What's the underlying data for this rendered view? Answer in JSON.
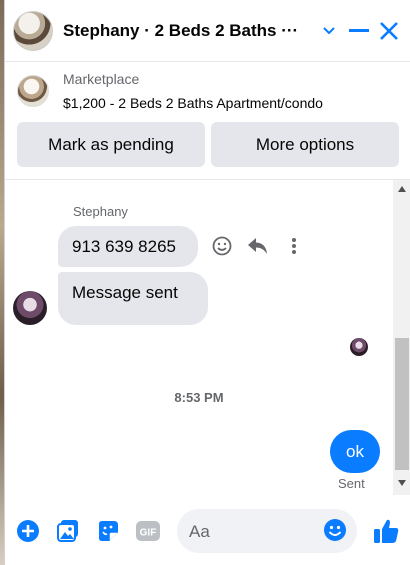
{
  "header": {
    "title": "Stephany · 2 Beds 2 Baths ···"
  },
  "marketplace": {
    "label": "Marketplace",
    "listing": "$1,200 - 2 Beds 2 Baths Apartment/condo"
  },
  "actions": {
    "mark_pending": "Mark as pending",
    "more_options": "More options"
  },
  "messages": {
    "sender_name": "Stephany",
    "incoming": [
      "913 639 8265",
      "Message sent"
    ],
    "timestamp": "8:53 PM",
    "outgoing": "ok",
    "status": "Sent"
  },
  "composer": {
    "placeholder": "Aa"
  },
  "colors": {
    "accent": "#0a7cff",
    "bubble_in": "#e4e6eb",
    "muted_text": "#65676b"
  },
  "icons": {
    "header": [
      "chevron-down-icon",
      "minimize-icon",
      "close-icon"
    ],
    "message_tools": [
      "emoji-reaction-icon",
      "reply-icon",
      "more-vertical-icon"
    ],
    "composer": [
      "plus-circle-icon",
      "photo-icon",
      "sticker-icon",
      "gif-icon",
      "emoji-icon",
      "thumbs-up-icon"
    ]
  }
}
